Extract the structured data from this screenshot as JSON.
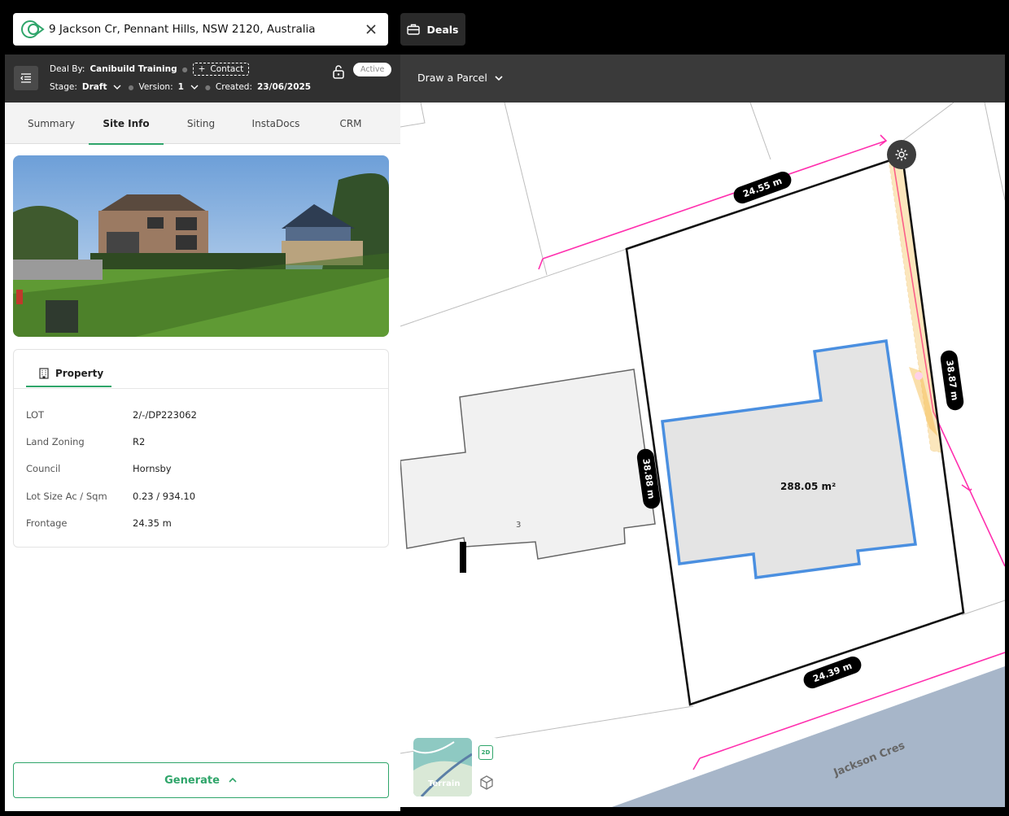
{
  "search": {
    "address": "9 Jackson Cr, Pennant Hills, NSW 2120, Australia"
  },
  "nav": {
    "deals_label": "Deals"
  },
  "deal": {
    "deal_by_prefix": "Deal By:",
    "deal_by": "Canibuild Training",
    "contact_label": "Contact",
    "stage_prefix": "Stage:",
    "stage": "Draft",
    "version_prefix": "Version:",
    "version": "1",
    "created_prefix": "Created:",
    "created": "23/06/2025",
    "status": "Active"
  },
  "tabs": [
    "Summary",
    "Site Info",
    "Siting",
    "InstaDocs",
    "CRM"
  ],
  "active_tab": "Site Info",
  "property": {
    "tab_label": "Property",
    "rows": [
      {
        "key": "LOT",
        "value": "2/-/DP223062"
      },
      {
        "key": "Land Zoning",
        "value": "R2"
      },
      {
        "key": "Council",
        "value": "Hornsby"
      },
      {
        "key": "Lot Size Ac / Sqm",
        "value": "0.23 / 934.10"
      },
      {
        "key": "Frontage",
        "value": "24.35 m"
      }
    ]
  },
  "generate_label": "Generate",
  "map": {
    "draw_parcel_label": "Draw a Parcel",
    "dimensions": {
      "top": "24.55 m",
      "right": "38.87 m",
      "left": "38.88 m",
      "bottom": "24.39 m"
    },
    "footprint_area": "288.05 m²",
    "neighbour_lot": "3",
    "street": "Jackson Cres",
    "terrain_label": "Terrain",
    "view_2d": "2D"
  },
  "colors": {
    "accent": "#2fa56a",
    "boundary": "#ff2fae",
    "footprint": "#4a8fe0",
    "easement": "#f5b843"
  }
}
